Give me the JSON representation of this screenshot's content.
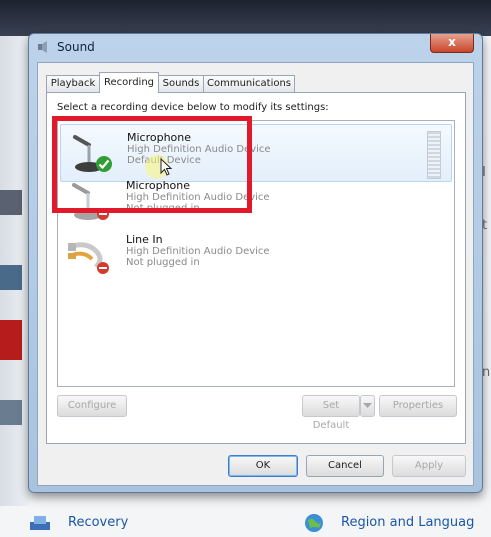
{
  "background": {
    "right_fragment_1": "I",
    "right_fragment_2": "t",
    "right_fragment_3": "n",
    "bottom_left_label": "Recovery",
    "bottom_right_label": "Region and Languag"
  },
  "dialog": {
    "title": "Sound",
    "close_label": "x"
  },
  "tabs": [
    {
      "label": "Playback",
      "active": false
    },
    {
      "label": "Recording",
      "active": true
    },
    {
      "label": "Sounds",
      "active": false
    },
    {
      "label": "Communications",
      "active": false
    }
  ],
  "recording": {
    "instruction": "Select a recording device below to modify its settings:",
    "devices": [
      {
        "name": "Microphone",
        "detail": "High Definition Audio Device",
        "status": "Default Device",
        "status_icon": "check-icon",
        "selected": true
      },
      {
        "name": "Microphone",
        "detail": "High Definition Audio Device",
        "status": "Not plugged in",
        "status_icon": "unplugged-icon",
        "selected": false
      },
      {
        "name": "Line In",
        "detail": "High Definition Audio Device",
        "status": "Not plugged in",
        "status_icon": "unplugged-icon",
        "selected": false
      }
    ],
    "buttons": {
      "configure": "Configure",
      "set_default": "Set Default",
      "properties": "Properties"
    }
  },
  "footer": {
    "ok": "OK",
    "cancel": "Cancel",
    "apply": "Apply"
  },
  "colors": {
    "highlight": "#e1192a",
    "selection": "#e3effb"
  }
}
